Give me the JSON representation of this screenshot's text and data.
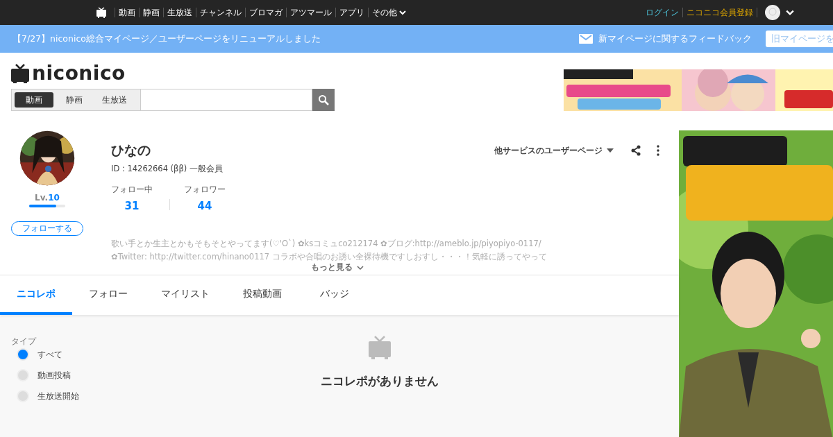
{
  "top_bar": {
    "nav": [
      "動画",
      "静画",
      "生放送",
      "チャンネル",
      "ブロマガ",
      "アツマール",
      "アプリ",
      "その他"
    ],
    "login": "ログイン",
    "register": "ニコニコ会員登録"
  },
  "notice": {
    "text": "【7/27】niconico総合マイページ／ユーザーページをリニューアルしました",
    "feedback": "新マイページに関するフィードバック",
    "old_page_button": "旧マイページを"
  },
  "header": {
    "logo": "niconico",
    "search_tabs": [
      {
        "label": "動画",
        "selected": true
      },
      {
        "label": "静画",
        "selected": false
      },
      {
        "label": "生放送",
        "selected": false
      }
    ]
  },
  "profile": {
    "name": "ひなの",
    "id_line": "ID : 14262664 (ββ) 一般会員",
    "level_label": "Lv.",
    "level_value": "10",
    "level": 0.75,
    "follow_button": "フォローする",
    "other_services": "他サービスのユーザーページ",
    "stats": [
      {
        "label": "フォロー中",
        "value": "31"
      },
      {
        "label": "フォロワー",
        "value": "44"
      }
    ],
    "description": [
      "歌い手とか生主とかもそもそとやってます(♡'O`) ✿ksコミュco212174 ✿ブログ:http://ameblo.jp/piyopiyo-0117/",
      "✿Twitter: http://twitter.com/hinano0117 コラボや合唱のお誘い全裸待機ですしおすし・・・！気軽に誘ってやって"
    ],
    "more": "もっと見る"
  },
  "tabs": [
    {
      "label": "ニコレポ",
      "selected": true
    },
    {
      "label": "フォロー",
      "selected": false
    },
    {
      "label": "マイリスト",
      "selected": false
    },
    {
      "label": "投稿動画",
      "selected": false
    },
    {
      "label": "バッジ",
      "selected": false
    }
  ],
  "filter": {
    "title": "タイプ",
    "options": [
      {
        "label": "すべて",
        "selected": true
      },
      {
        "label": "動画投稿",
        "selected": false
      },
      {
        "label": "生放送開始",
        "selected": false
      }
    ]
  },
  "empty_message": "ニコレポがありません"
}
